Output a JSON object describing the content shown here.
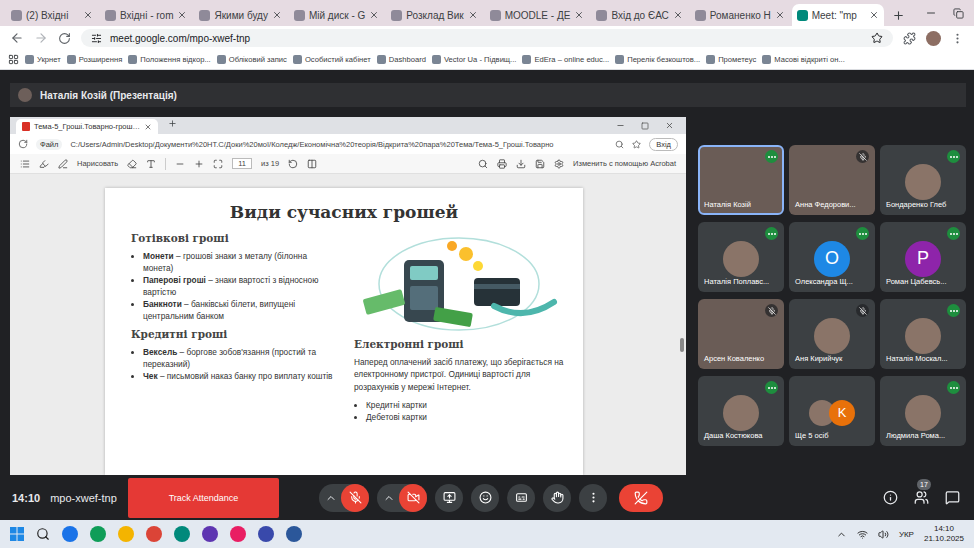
{
  "browser": {
    "tabs": [
      {
        "label": "(2) Вхідні",
        "selected": false
      },
      {
        "label": "Вхідні - rom",
        "selected": false
      },
      {
        "label": "Якими буду",
        "selected": false
      },
      {
        "label": "Мій диск - G",
        "selected": false
      },
      {
        "label": "Розклад Вик",
        "selected": false
      },
      {
        "label": "MOODLE - ДЕ",
        "selected": false
      },
      {
        "label": "Вхід до ЄАС",
        "selected": false
      },
      {
        "label": "Романенко Н",
        "selected": false
      },
      {
        "label": "Meet: \"mp",
        "selected": true
      }
    ],
    "url": "meet.google.com/mpo-xwef-tnp",
    "bookmarks": [
      "Укрнет",
      "Розширення",
      "Положення відкор...",
      "Обліковий запис",
      "Особистий кабінет",
      "Dashboard",
      "Vector Ua - Підвищ...",
      "EdEra – online educ...",
      "Перелік безкоштов...",
      "Прометеус",
      "Масові відкриті он..."
    ]
  },
  "meet": {
    "presenter": "Наталія Козій (Презентація)",
    "clock": "14:10",
    "meeting_code": "mpo-xwef-tnp",
    "attendance_button": "Track Attendance",
    "participants_count": "17",
    "mic_muted": true,
    "camera_off": true
  },
  "viewer": {
    "tab": "Тема-5_Гроші.Товарно-грош…",
    "file_chip": "Файл",
    "path": "C:/Users/Admin/Desktop/Документи%20НТ.С/Доки%20мої/Коледж/Економічна%20теорія/Відкрита%20пара%20Тема/Тема-5_Гроші.Товарно",
    "signin": "Вхід",
    "draw_label": "Нарисовать",
    "page": "11",
    "page_total": "из 19",
    "acrobat": "Изменить с помощью Acrobat"
  },
  "slide": {
    "title": "Види сучасних грошей",
    "left_sections": [
      {
        "heading": "Готівкові гроші",
        "items": [
          {
            "term": "Монети",
            "desc": " – грошові знаки з металу (білонна монета)"
          },
          {
            "term": "Паперові гроші",
            "desc": " – знаки вартості з відносною вартістю"
          },
          {
            "term": "Банкноти",
            "desc": " – банківські білети, випущені центральним банком"
          }
        ]
      },
      {
        "heading": "Кредитні гроші",
        "items": [
          {
            "term": "Вексель",
            "desc": " – боргове зобов'язання (простий та переказний)"
          },
          {
            "term": "Чек",
            "desc": " – письмовий наказ банку про виплату коштів"
          }
        ]
      }
    ],
    "right_section": {
      "heading": "Електронні гроші",
      "text": "Наперед оплачений засіб платежу, що зберігається на електронному пристрої. Одиниці вартості для розрахунків у мережі Інтернет.",
      "items": [
        "Кредитні картки",
        "Дебетові картки"
      ]
    }
  },
  "participants": [
    {
      "name": "Наталія Козій",
      "kind": "video",
      "muted": false,
      "speaking": true
    },
    {
      "name": "Анна Федорови...",
      "kind": "video",
      "muted": true,
      "speaking": false
    },
    {
      "name": "Бондаренко Глеб",
      "kind": "photo",
      "muted": false,
      "speaking": false
    },
    {
      "name": "Наталія Поплавс...",
      "kind": "photo",
      "muted": false,
      "speaking": false
    },
    {
      "name": "Олександра Щ...",
      "kind": "letter",
      "letter": "O",
      "color": "#1e88e5",
      "muted": false,
      "speaking": false
    },
    {
      "name": "Роман Цабевсь...",
      "kind": "letter",
      "letter": "P",
      "color": "#8e24aa",
      "muted": false,
      "speaking": false
    },
    {
      "name": "Арсен Коваленко",
      "kind": "video",
      "muted": true,
      "speaking": false
    },
    {
      "name": "Аня Кирийчук",
      "kind": "photo",
      "muted": true,
      "speaking": false
    },
    {
      "name": "Наталія Москал...",
      "kind": "photo",
      "muted": false,
      "speaking": false
    },
    {
      "name": "Даша Костюкова",
      "kind": "photo",
      "muted": false,
      "speaking": false
    },
    {
      "name": "Ще 5 осіб",
      "kind": "group",
      "letter": "K",
      "color": "#e8710a",
      "speaking": false
    },
    {
      "name": "Людмила Рома...",
      "kind": "photo",
      "muted": false,
      "speaking": false
    }
  ],
  "taskbar": {
    "lang": "УКР",
    "time": "14:10",
    "date": "21.10.2025"
  }
}
